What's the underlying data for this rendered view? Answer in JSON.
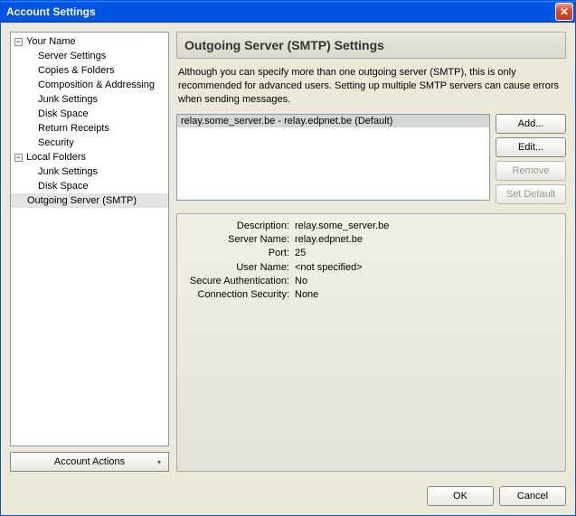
{
  "window": {
    "title": "Account Settings"
  },
  "sidebar": {
    "accounts": [
      {
        "label": "Your Name",
        "children": [
          {
            "label": "Server Settings"
          },
          {
            "label": "Copies & Folders"
          },
          {
            "label": "Composition & Addressing"
          },
          {
            "label": "Junk Settings"
          },
          {
            "label": "Disk Space"
          },
          {
            "label": "Return Receipts"
          },
          {
            "label": "Security"
          }
        ]
      },
      {
        "label": "Local Folders",
        "children": [
          {
            "label": "Junk Settings"
          },
          {
            "label": "Disk Space"
          }
        ]
      }
    ],
    "outgoing": {
      "label": "Outgoing Server (SMTP)",
      "selected": true
    },
    "account_actions": "Account Actions"
  },
  "main": {
    "title": "Outgoing Server (SMTP) Settings",
    "description": "Although you can specify more than one outgoing server (SMTP), this is only recommended for advanced users. Setting up multiple SMTP servers can cause errors when sending messages.",
    "list": [
      {
        "label": "relay.some_server.be - relay.edpnet.be (Default)",
        "selected": true
      }
    ],
    "buttons": {
      "add": "Add...",
      "edit": "Edit...",
      "remove": "Remove",
      "set_default": "Set Default"
    },
    "details": {
      "rows": [
        {
          "label": "Description:",
          "value": "relay.some_server.be"
        },
        {
          "label": "Server Name:",
          "value": "relay.edpnet.be"
        },
        {
          "label": "Port:",
          "value": "25"
        },
        {
          "label": "User Name:",
          "value": "<not specified>"
        },
        {
          "label": "Secure Authentication:",
          "value": "No"
        },
        {
          "label": "Connection Security:",
          "value": "None"
        }
      ]
    }
  },
  "footer": {
    "ok": "OK",
    "cancel": "Cancel"
  }
}
